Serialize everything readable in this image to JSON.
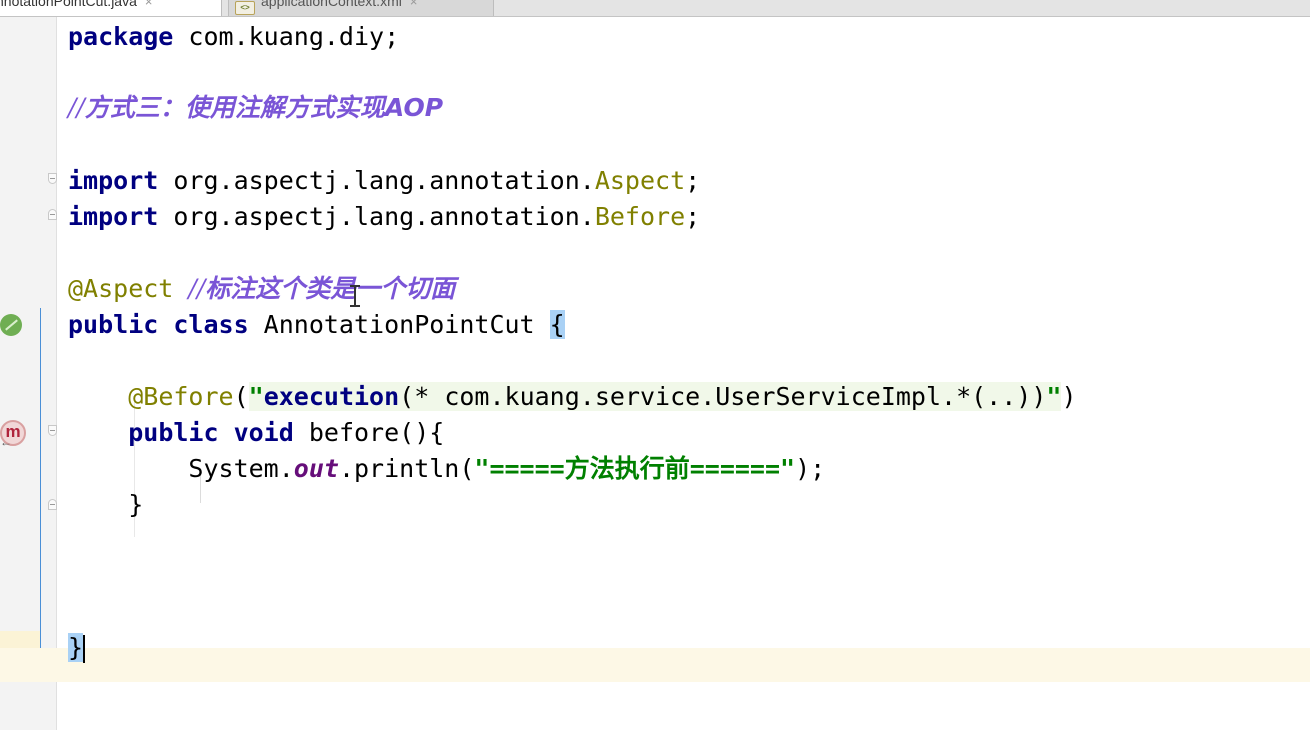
{
  "tabs": [
    {
      "label": "nnotationPointCut.java",
      "close": "×",
      "active": true
    },
    {
      "label": "applicationContext.xml",
      "close": "×",
      "active": false,
      "icon": "xml-file-icon"
    }
  ],
  "icons": {
    "bean": "spring-bean-icon",
    "method": "method-icon",
    "method_glyph": "m",
    "method_arrow": "←"
  },
  "code": {
    "l1_kw": "package",
    "l1_rest": " com.kuang.diy;",
    "l2_comment_prefix": "//",
    "l2_comment_text": "方式三：使用注解方式实现AOP",
    "l3_kw": "import",
    "l3_pkg": " org.aspectj.lang.annotation.",
    "l3_cls": "Aspect",
    "l3_semi": ";",
    "l4_kw": "import",
    "l4_pkg": " org.aspectj.lang.annotation.",
    "l4_cls": "Before",
    "l4_semi": ";",
    "l5_ann": "@Aspect",
    "l5_space": " ",
    "l5_comment_prefix": "//",
    "l5_comment_text": "标注这个类是一个切面",
    "l6_kw1": "public",
    "l6_kw2": " class",
    "l6_name": " AnnotationPointCut ",
    "l6_brace": "{",
    "l7_indent": "    ",
    "l7_ann": "@Before",
    "l7_paren": "(",
    "l7_q1": "\"",
    "l7_exec": "execution",
    "l7_expr": "(* com.kuang.service.UserServiceImpl.*(..))",
    "l7_q2": "\"",
    "l7_close": ")",
    "l8_indent": "    ",
    "l8_kw1": "public",
    "l8_kw2": " void",
    "l8_rest": " before(){",
    "l9_indent": "        ",
    "l9_sys": "System.",
    "l9_out": "out",
    "l9_println": ".println(",
    "l9_str": "\"=====方法执行前======\"",
    "l9_end": ");",
    "l10_indent": "    ",
    "l10_brace": "}",
    "l11_brace": "}"
  }
}
